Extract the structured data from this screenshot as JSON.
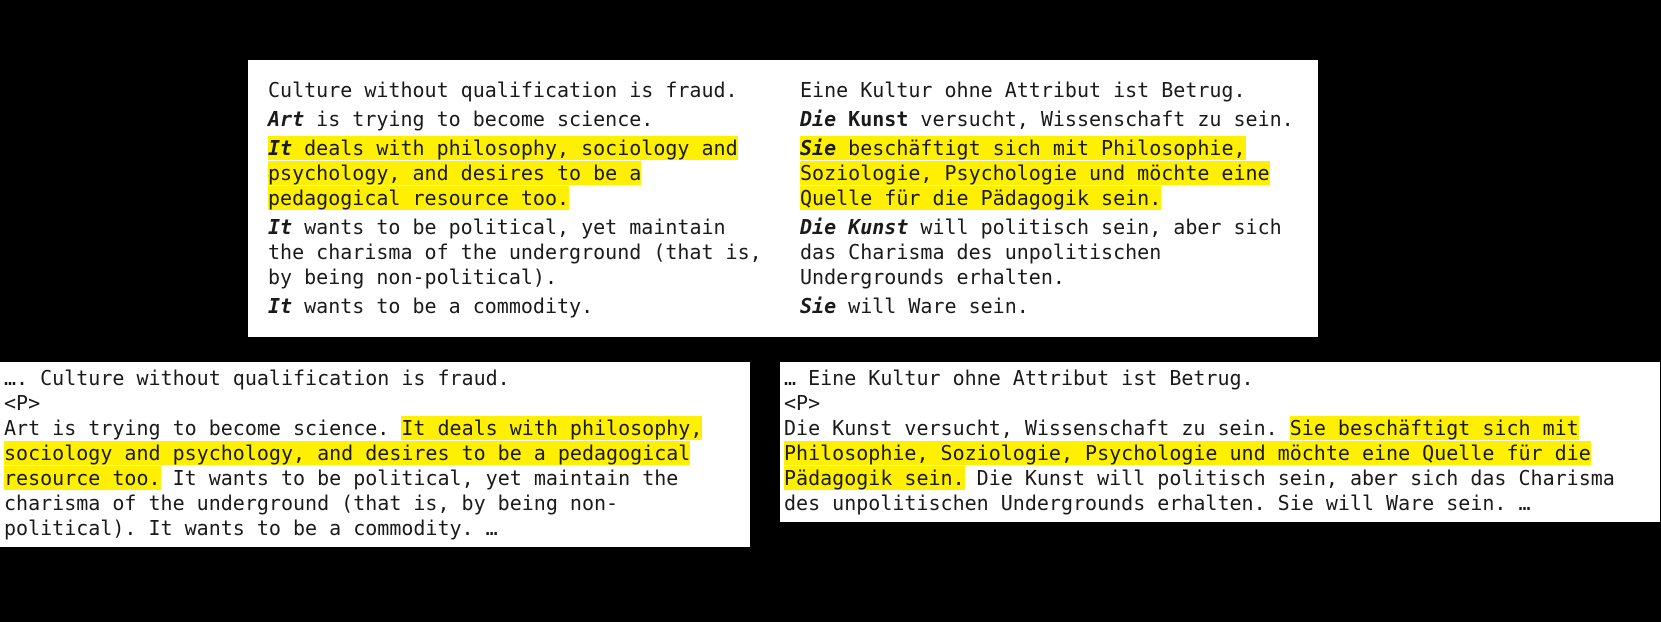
{
  "top": {
    "rows": [
      {
        "en": {
          "lead": "",
          "rest": "Culture without qualification is fraud.",
          "highlight": false
        },
        "de": {
          "lead": "",
          "rest": "Eine Kultur ohne Attribut ist Betrug.",
          "highlight": false
        }
      },
      {
        "en": {
          "lead": "Art",
          "rest": " is trying to become science.",
          "highlight": false,
          "leadBold": true
        },
        "de": {
          "lead": "Die",
          "rest": " versucht, Wissenschaft zu sein.",
          "lead2": "Kunst",
          "highlight": false
        }
      },
      {
        "en": {
          "lead": "It",
          "rest": " deals with philosophy, sociology and psychology, and desires to be a pedagogical resource too.",
          "highlight": true
        },
        "de": {
          "lead": "Sie",
          "rest": " beschäftigt sich mit Philosophie, Soziologie, Psychologie und möchte eine Quelle für die Pädagogik sein.",
          "highlight": true
        }
      },
      {
        "en": {
          "lead": "It",
          "rest": " wants to be political, yet maintain the charisma of the underground (that is, by being non-political).",
          "highlight": false
        },
        "de": {
          "lead": "Die Kunst",
          "rest": " will politisch sein, aber sich das Charisma des unpolitischen Undergrounds erhalten.",
          "highlight": false
        }
      },
      {
        "en": {
          "lead": "It",
          "rest": " wants to be a commodity.",
          "highlight": false
        },
        "de": {
          "lead": "Sie",
          "rest": " will Ware sein.",
          "highlight": false
        }
      }
    ]
  },
  "bottom": {
    "en": {
      "pre": "…. Culture without qualification is fraud.",
      "tag": "<P>",
      "p1": "Art is trying to become science. ",
      "hl": "It deals with philosophy, sociology and psychology, and desires to be a pedagogical resource too.",
      "p2": " It wants to be political, yet maintain the charisma of the underground (that is, by being non-political). It wants to be a commodity. …"
    },
    "de": {
      "pre": "… Eine Kultur ohne Attribut ist Betrug.",
      "tag": "<P>",
      "p1": "Die Kunst versucht, Wissenschaft zu sein. ",
      "hl": "Sie beschäftigt sich mit Philosophie, Soziologie, Psychologie und möchte eine Quelle für die Pädagogik sein.",
      "p2": " Die Kunst will politisch sein, aber sich das Charisma des unpolitischen Undergrounds erhalten. Sie will Ware sein. …"
    }
  }
}
